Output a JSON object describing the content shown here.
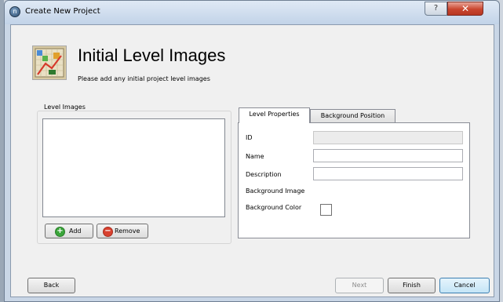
{
  "window": {
    "title": "Create New Project",
    "app_icon_glyph": "n",
    "help_glyph": "?",
    "close_glyph": "✕"
  },
  "header": {
    "title": "Initial Level Images",
    "subtitle": "Please add any initial project level images",
    "icon": "level-images-icon"
  },
  "level_images": {
    "group_label": "Level Images",
    "items": [],
    "add_label": "Add",
    "remove_label": "Remove",
    "add_icon": "green-plus-circle-icon",
    "remove_icon": "red-minus-circle-icon"
  },
  "tabs": [
    {
      "label": "Level Properties",
      "active": true
    },
    {
      "label": "Background Position",
      "active": false
    }
  ],
  "properties": {
    "id_label": "ID",
    "id_value": "",
    "name_label": "Name",
    "name_value": "",
    "description_label": "Description",
    "description_value": "",
    "background_image_label": "Background Image",
    "background_color_label": "Background Color"
  },
  "footer": {
    "back_label": "Back",
    "next_label": "Next",
    "finish_label": "Finish",
    "cancel_label": "Cancel"
  },
  "colors": {
    "accent": "#3c7fb1",
    "close_red": "#c9462f",
    "add_green": "#3aa53a",
    "remove_red": "#d9412f"
  }
}
